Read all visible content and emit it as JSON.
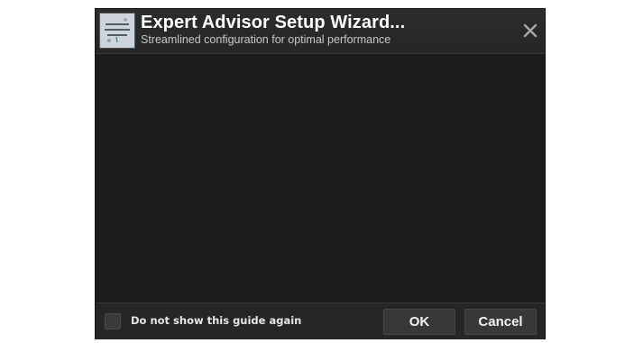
{
  "dialog": {
    "title": "Expert Advisor Setup Wizard...",
    "subtitle": "Streamlined configuration for optimal performance",
    "logo_icon": "ea-logo-icon",
    "close_icon": "close-icon"
  },
  "footer": {
    "checkbox_label": "Do not show this guide again",
    "checkbox_checked": false,
    "ok_label": "OK",
    "cancel_label": "Cancel"
  },
  "colors": {
    "dialog_bg": "#1c1c1c",
    "header_bg": "#2a2a2a",
    "footer_bg": "#262626",
    "button_bg": "#383838",
    "text": "#ffffff"
  }
}
